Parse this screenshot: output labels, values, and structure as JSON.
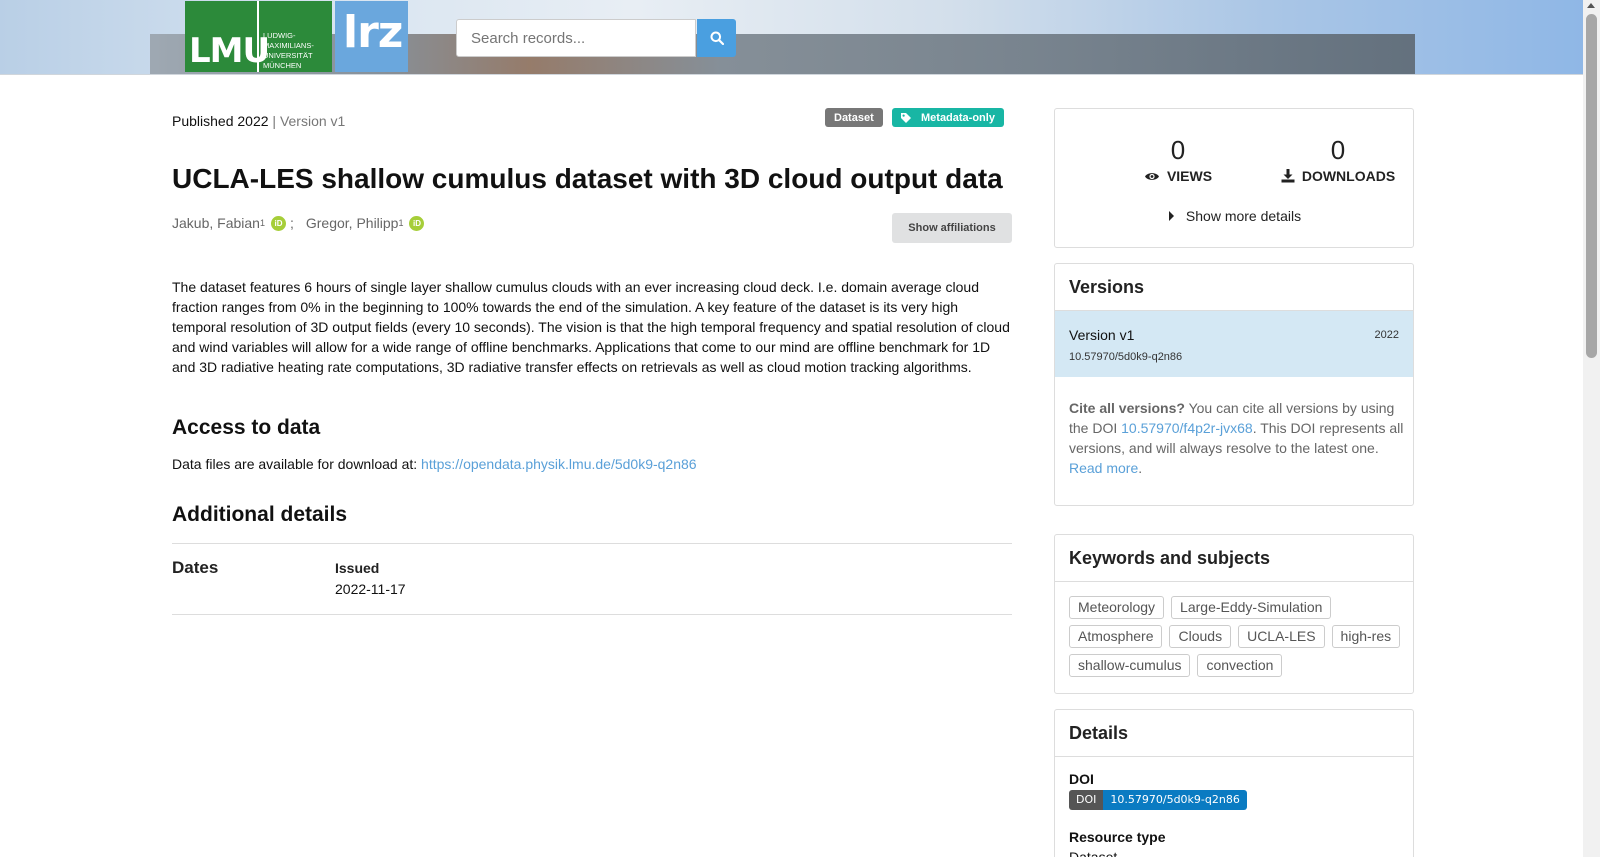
{
  "header": {
    "logo_lmu_text": "LMU",
    "logo_lmu_subtext": [
      "LUDWIG-",
      "MAXIMILIANS-",
      "UNIVERSITÄT",
      "MÜNCHEN"
    ],
    "logo_lrz_text": "lrz",
    "search_placeholder": "Search records..."
  },
  "record": {
    "published": "Published 2022",
    "version": "Version v1",
    "resource_badge": "Dataset",
    "access_badge": "Metadata-only",
    "title": "UCLA-LES shallow cumulus dataset with 3D cloud output data",
    "authors": [
      {
        "name": "Jakub, Fabian",
        "sup": "1",
        "sep": ";"
      },
      {
        "name": "Gregor, Philipp",
        "sup": "1"
      }
    ],
    "show_affiliations": "Show affiliations",
    "description": "The dataset features 6 hours of single layer shallow cumulus clouds with an ever increasing cloud deck. I.e. domain average cloud fraction ranges from 0% in the beginning to 100% towards the end of the simulation. A key feature of the dataset is its very high temporal resolution of 3D output fields (every 10 seconds). The vision is that the high temporal frequency and spatial resolution of cloud and wind variables will allow for a wide range of offline benchmarks. Applications that come to our mind are offline benchmark for 1D and 3D radiative heating rate computations, 3D radiative transfer effects on retrievals as well as cloud motion tracking algorithms.",
    "access_heading": "Access to data",
    "access_text": "Data files are available for download at:",
    "access_link": "https://opendata.physik.lmu.de/5d0k9-q2n86",
    "additional_heading": "Additional details",
    "dates_label": "Dates",
    "issued_label": "Issued",
    "issued_value": "2022-11-17"
  },
  "stats": {
    "views": "0",
    "views_label": "VIEWS",
    "downloads": "0",
    "downloads_label": "DOWNLOADS",
    "more_details": "Show more details"
  },
  "versions": {
    "title": "Versions",
    "items": [
      {
        "name": "Version v1",
        "year": "2022",
        "doi": "10.57970/5d0k9-q2n86"
      }
    ],
    "cite_bold": "Cite all versions?",
    "cite_text1": "You can cite all versions by using the DOI",
    "cite_doi": "10.57970/f4p2r-jvx68",
    "cite_text2": ". This DOI represents all versions, and will always resolve to the latest one.",
    "read_more": "Read more",
    "read_more_end": "."
  },
  "keywords": {
    "title": "Keywords and subjects",
    "items": [
      "Meteorology",
      "Large-Eddy-Simulation",
      "Atmosphere",
      "Clouds",
      "UCLA-LES",
      "high-res",
      "shallow-cumulus",
      "convection"
    ]
  },
  "details": {
    "title": "Details",
    "doi_label": "DOI",
    "doi_prefix": "DOI",
    "doi_value": "10.57970/5d0k9-q2n86",
    "resource_type_label": "Resource type",
    "resource_type_value": "Dataset"
  },
  "colors": {
    "lmu_green": "#2c8a3a",
    "lrz_blue": "#6aa7dd",
    "link_blue": "#5aa0d8",
    "metadata_badge": "#18b6a4",
    "version_row_bg": "#d4e8f4",
    "doi_badge_blue": "#0a7bc2"
  },
  "icons": {
    "search": "search-icon",
    "tag": "tag-icon",
    "orcid": "orcid-icon",
    "eye": "eye-icon",
    "download": "download-icon",
    "caret": "caret-right-icon"
  }
}
